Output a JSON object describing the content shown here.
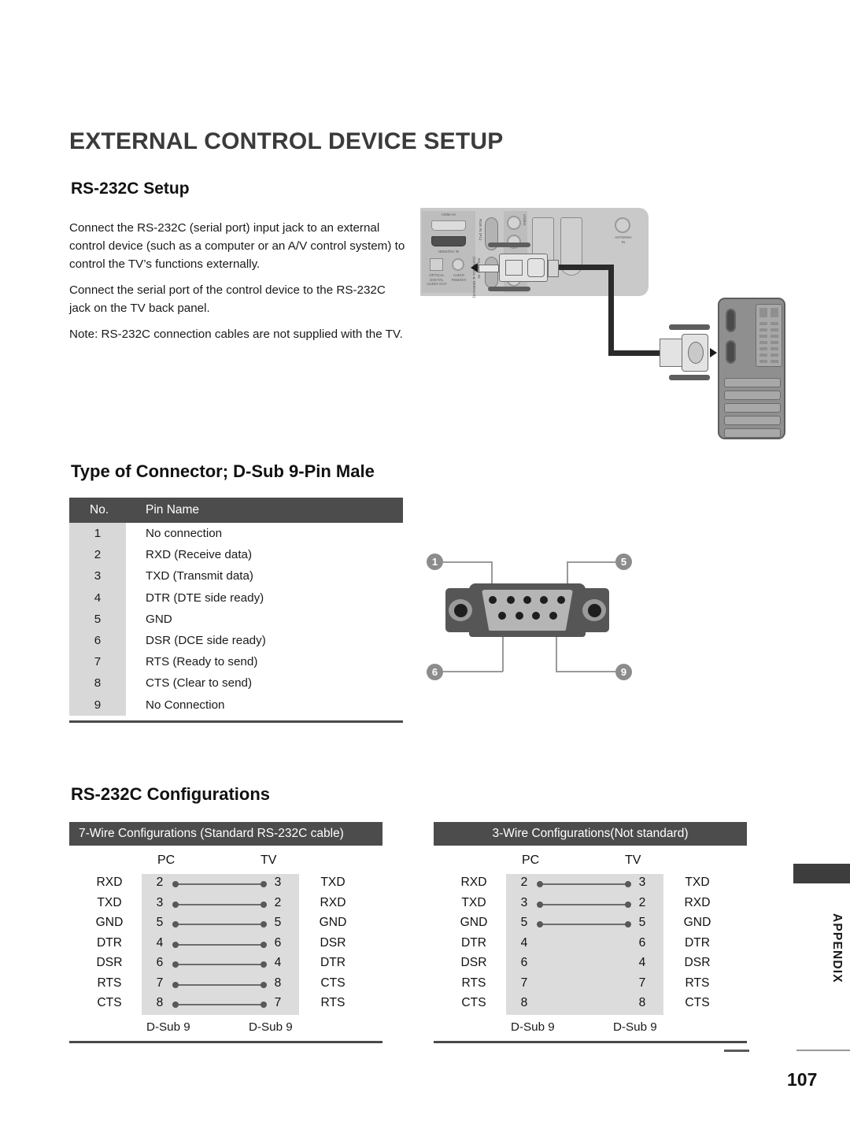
{
  "document": {
    "main_title": "EXTERNAL CONTROL DEVICE SETUP",
    "page_number": "107",
    "section_tab": "APPENDIX"
  },
  "setup": {
    "heading": "RS-232C Setup",
    "paragraphs": [
      "Connect the RS-232C (serial port) input jack to an external control device (such as a computer or an A/V control system) to control the TV’s functions externally.",
      "Connect the serial port of the control device to the RS-232C jack on the TV back panel.",
      "Note: RS-232C connection cables are not supplied with the TV."
    ]
  },
  "illustration": {
    "panel_labels": {
      "hdmi_in": "HDMI IN",
      "hdmi_dvi_in": "HDMI/DVI IN",
      "rgb_in_pc": "RGB IN (PC)",
      "rs232c": "RS-232C IN\n(CONTROL & SERVICE)",
      "optical": "OPTICAL\nDIGITAL\nAUDIO OUT",
      "audio_rgb": "AUDIO\nRGB/DVI",
      "antenna_in": "ANTENNA\nIN",
      "video": "VIDEO"
    }
  },
  "connector": {
    "heading": "Type of Connector; D-Sub 9-Pin Male",
    "columns": [
      "No.",
      "Pin Name"
    ],
    "rows": [
      {
        "no": "1",
        "name": "No connection"
      },
      {
        "no": "2",
        "name": "RXD (Receive data)"
      },
      {
        "no": "3",
        "name": "TXD (Transmit data)"
      },
      {
        "no": "4",
        "name": "DTR (DTE side ready)"
      },
      {
        "no": "5",
        "name": "GND"
      },
      {
        "no": "6",
        "name": "DSR (DCE side ready)"
      },
      {
        "no": "7",
        "name": "RTS (Ready to send)"
      },
      {
        "no": "8",
        "name": "CTS (Clear to send)"
      },
      {
        "no": "9",
        "name": "No Connection"
      }
    ],
    "diagram_badges": {
      "top_left": "1",
      "top_right": "5",
      "bottom_left": "6",
      "bottom_right": "9"
    }
  },
  "configurations": {
    "heading": "RS-232C Configurations",
    "tables": [
      {
        "title": "7-Wire Configurations (Standard RS-232C cable)",
        "col_pc": "PC",
        "col_tv": "TV",
        "foot_left": "D-Sub 9",
        "foot_right": "D-Sub 9",
        "rows": [
          {
            "left_name": "RXD",
            "left_pin": "2",
            "right_pin": "3",
            "right_name": "TXD",
            "connected": true
          },
          {
            "left_name": "TXD",
            "left_pin": "3",
            "right_pin": "2",
            "right_name": "RXD",
            "connected": true
          },
          {
            "left_name": "GND",
            "left_pin": "5",
            "right_pin": "5",
            "right_name": "GND",
            "connected": true
          },
          {
            "left_name": "DTR",
            "left_pin": "4",
            "right_pin": "6",
            "right_name": "DSR",
            "connected": true
          },
          {
            "left_name": "DSR",
            "left_pin": "6",
            "right_pin": "4",
            "right_name": "DTR",
            "connected": true
          },
          {
            "left_name": "RTS",
            "left_pin": "7",
            "right_pin": "8",
            "right_name": "CTS",
            "connected": true
          },
          {
            "left_name": "CTS",
            "left_pin": "8",
            "right_pin": "7",
            "right_name": "RTS",
            "connected": true
          }
        ]
      },
      {
        "title": "3-Wire Configurations(Not standard)",
        "col_pc": "PC",
        "col_tv": "TV",
        "foot_left": "D-Sub 9",
        "foot_right": "D-Sub 9",
        "rows": [
          {
            "left_name": "RXD",
            "left_pin": "2",
            "right_pin": "3",
            "right_name": "TXD",
            "connected": true
          },
          {
            "left_name": "TXD",
            "left_pin": "3",
            "right_pin": "2",
            "right_name": "RXD",
            "connected": true
          },
          {
            "left_name": "GND",
            "left_pin": "5",
            "right_pin": "5",
            "right_name": "GND",
            "connected": true
          },
          {
            "left_name": "DTR",
            "left_pin": "4",
            "right_pin": "6",
            "right_name": "DTR",
            "connected": false
          },
          {
            "left_name": "DSR",
            "left_pin": "6",
            "right_pin": "4",
            "right_name": "DSR",
            "connected": false
          },
          {
            "left_name": "RTS",
            "left_pin": "7",
            "right_pin": "7",
            "right_name": "RTS",
            "connected": false
          },
          {
            "left_name": "CTS",
            "left_pin": "8",
            "right_pin": "8",
            "right_name": "CTS",
            "connected": false
          }
        ]
      }
    ]
  },
  "colors": {
    "header_bar": "#4c4c4c",
    "shade": "#dcdcdc",
    "title": "#3b3b3b"
  }
}
